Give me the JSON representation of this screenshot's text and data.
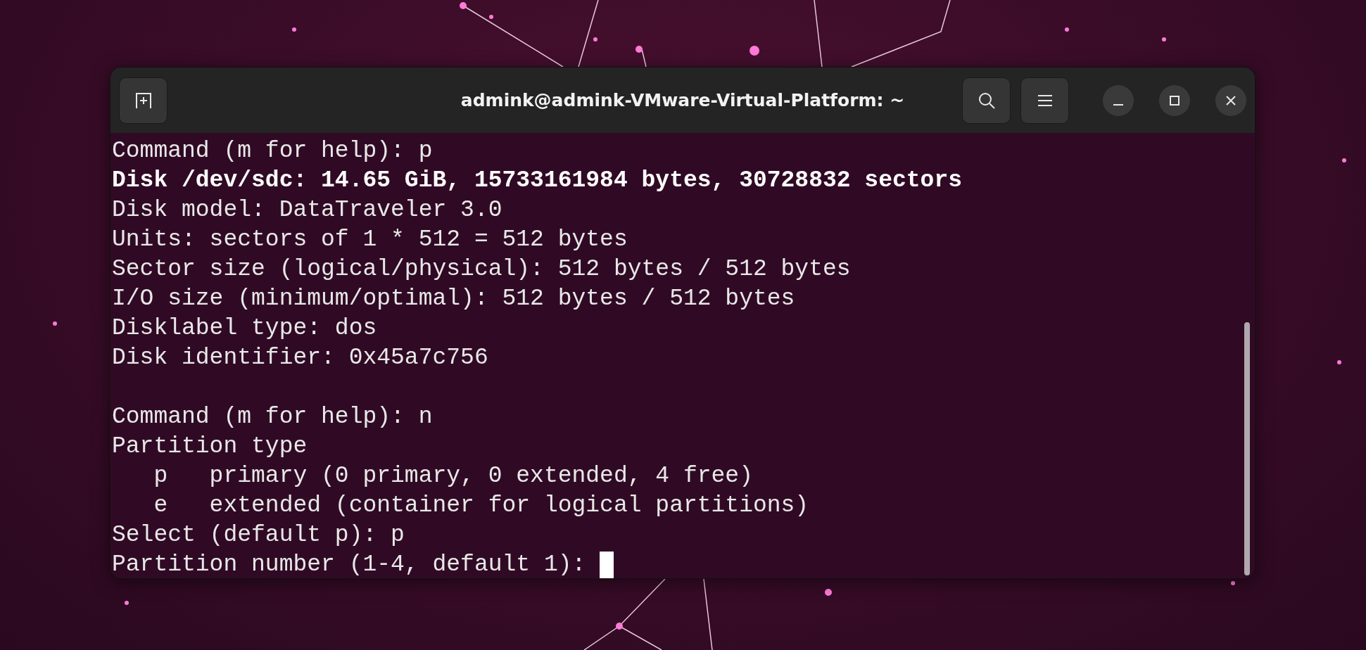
{
  "window": {
    "title": "admink@admink-VMware-Virtual-Platform: ~"
  },
  "terminal": {
    "lines": [
      {
        "kind": "text",
        "text": "Command (m for help): p"
      },
      {
        "kind": "bold",
        "text": "Disk /dev/sdc: 14.65 GiB, 15733161984 bytes, 30728832 sectors"
      },
      {
        "kind": "text",
        "text": "Disk model: DataTraveler 3.0"
      },
      {
        "kind": "text",
        "text": "Units: sectors of 1 * 512 = 512 bytes"
      },
      {
        "kind": "text",
        "text": "Sector size (logical/physical): 512 bytes / 512 bytes"
      },
      {
        "kind": "text",
        "text": "I/O size (minimum/optimal): 512 bytes / 512 bytes"
      },
      {
        "kind": "text",
        "text": "Disklabel type: dos"
      },
      {
        "kind": "text",
        "text": "Disk identifier: 0x45a7c756"
      },
      {
        "kind": "blank"
      },
      {
        "kind": "text",
        "text": "Command (m for help): n"
      },
      {
        "kind": "text",
        "text": "Partition type"
      },
      {
        "kind": "text",
        "text": "   p   primary (0 primary, 0 extended, 4 free)"
      },
      {
        "kind": "text",
        "text": "   e   extended (container for logical partitions)"
      },
      {
        "kind": "text",
        "text": "Select (default p): p"
      },
      {
        "kind": "prompt",
        "text": "Partition number (1-4, default 1): "
      }
    ]
  }
}
